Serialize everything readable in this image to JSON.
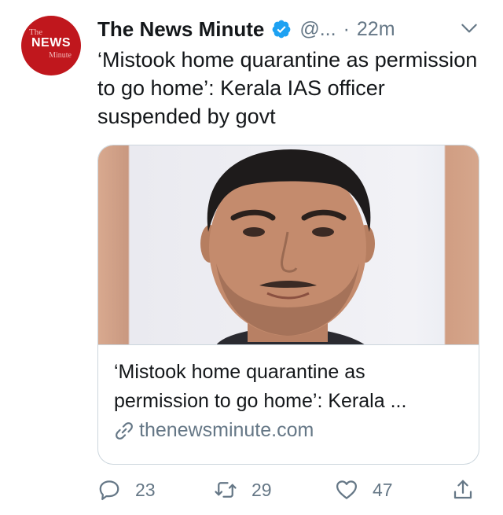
{
  "tweet": {
    "author_name": "The News Minute",
    "handle": "@...",
    "separator": "·",
    "time": "22m",
    "text": "‘Mistook home quarantine as permission to go home’: Kerala IAS officer suspended by govt",
    "avatar": {
      "top": "The",
      "middle": "NEWS",
      "bottom": "Minute",
      "color": "#c0171d"
    }
  },
  "card": {
    "title": "‘Mistook home quarantine as permission to go home’: Kerala ...",
    "domain": "thenewsminute.com"
  },
  "actions": {
    "replies": "23",
    "retweets": "29",
    "likes": "47"
  },
  "icons": {
    "verified": "verified-badge-icon",
    "caret": "chevron-down-icon",
    "link": "link-icon",
    "reply": "reply-icon",
    "retweet": "retweet-icon",
    "like": "heart-icon",
    "share": "share-icon"
  },
  "colors": {
    "text": "#14171a",
    "secondary": "#657786",
    "verified_blue": "#1da1f2",
    "border": "#ccd6dd"
  }
}
